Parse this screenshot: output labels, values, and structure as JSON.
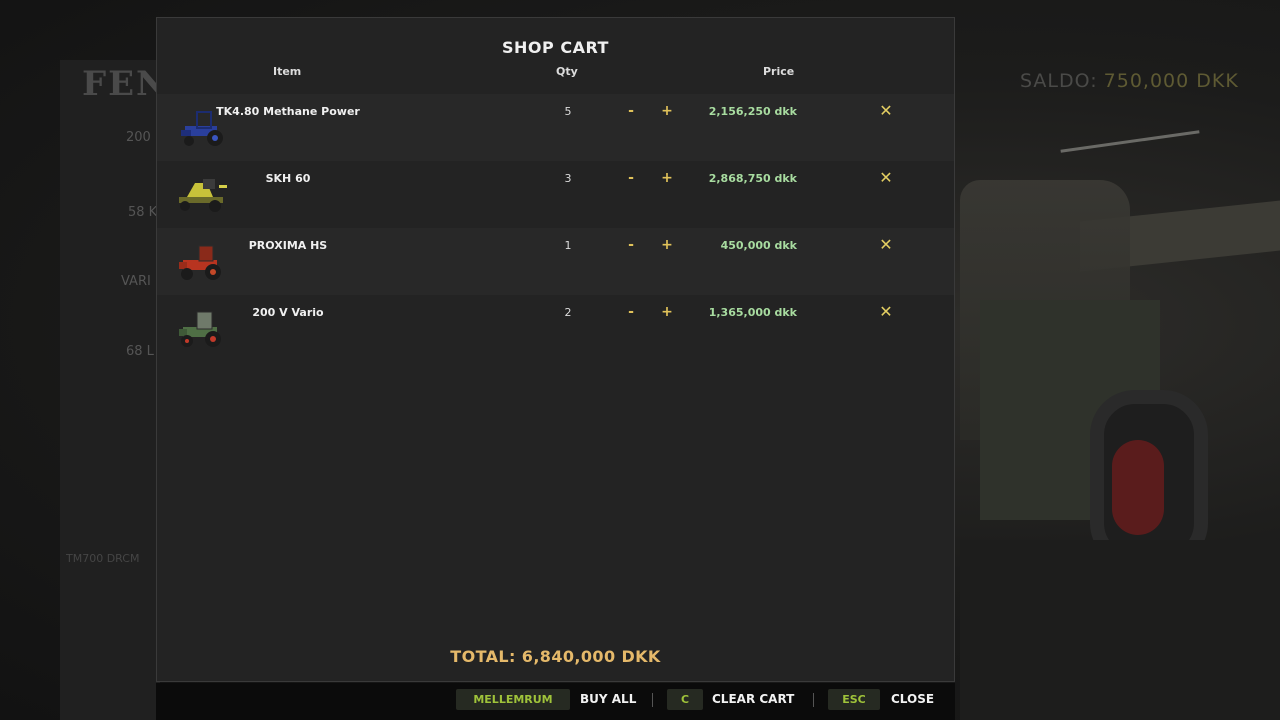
{
  "background": {
    "brand": "FEN",
    "specs": [
      "200",
      "58 K",
      "VARI",
      "68 L"
    ],
    "balance_label": "SALDO:",
    "balance_value": "750,000 DKK",
    "footer_hint": "TM700 DRCM"
  },
  "dialog": {
    "title": "SHOP CART",
    "columns": {
      "item": "Item",
      "qty": "Qty",
      "price": "Price"
    },
    "rows": [
      {
        "name": "TK4.80 Methane Power",
        "qty": "5",
        "price": "2,156,250 dkk",
        "minus": "-",
        "plus": "+",
        "remove": "✕",
        "icon": "blue-tractor-icon"
      },
      {
        "name": "SKH 60",
        "qty": "3",
        "price": "2,868,750 dkk",
        "minus": "-",
        "plus": "+",
        "remove": "✕",
        "icon": "yellow-harvester-icon"
      },
      {
        "name": "PROXIMA HS",
        "qty": "1",
        "price": "450,000 dkk",
        "minus": "-",
        "plus": "+",
        "remove": "✕",
        "icon": "red-tractor-icon"
      },
      {
        "name": "200 V Vario",
        "qty": "2",
        "price": "1,365,000 dkk",
        "minus": "-",
        "plus": "+",
        "remove": "✕",
        "icon": "green-tractor-icon"
      }
    ],
    "total": "TOTAL: 6,840,000 DKK"
  },
  "actions": [
    {
      "key": "MELLEMRUM",
      "label": "BUY ALL"
    },
    {
      "key": "C",
      "label": "CLEAR CART"
    },
    {
      "key": "ESC",
      "label": "CLOSE"
    }
  ],
  "colors": {
    "accent_key": "#9fc33a",
    "price_green": "#a8dca0",
    "total_orange": "#e5b96a",
    "control_yellow": "#e3ce62"
  }
}
